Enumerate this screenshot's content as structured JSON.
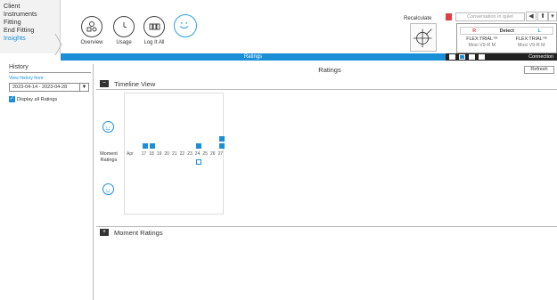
{
  "nav": {
    "items": [
      "Client",
      "Instruments",
      "Fitting",
      "End Fitting",
      "Insights"
    ],
    "active_index": 4
  },
  "tools": [
    {
      "label": "Overview",
      "icon": "overview-icon"
    },
    {
      "label": "Usage",
      "icon": "clock-icon"
    },
    {
      "label": "Log It All",
      "icon": "log-icon"
    }
  ],
  "ribbon": {
    "label": "Ratings"
  },
  "right_panel": {
    "recalculate_label": "Recalculate",
    "program_placeholder": "Conversation in quiet",
    "device": {
      "left_label": "R",
      "detect_label": "Detect",
      "right_label": "L",
      "left_name": "FLEX:TRIAL™",
      "left_model": "Moxi V9-R M",
      "right_name": "FLEX:TRIAL™",
      "right_model": "Moxi V9-R M"
    },
    "connection_label": "Connection",
    "plus": "+"
  },
  "sidebar": {
    "title": "History",
    "view_label": "View history from:",
    "range_value": "2023-04-14 - 2023-04-28",
    "display_all_label": "Display all Ratings"
  },
  "main": {
    "title": "Ratings",
    "refresh_label": "Refresh",
    "timeline_section": {
      "toggle": "−",
      "title": "Timeline View"
    },
    "moment_section": {
      "toggle": "+",
      "title": "Moment Ratings"
    },
    "row_label_line1": "Moment",
    "row_label_line2": "Ratings"
  },
  "chart_data": {
    "type": "scatter",
    "x": [
      "Apr",
      "17",
      "18",
      "19",
      "20",
      "21",
      "22",
      "23",
      "24",
      "25",
      "26",
      "27"
    ],
    "ratings": [
      {
        "day": "17",
        "level": "positive",
        "count": 1
      },
      {
        "day": "18",
        "level": "positive",
        "count": 1
      },
      {
        "day": "24",
        "level": "positive",
        "count": 1
      },
      {
        "day": "24",
        "level": "negative",
        "count": 1,
        "style": "outline"
      },
      {
        "day": "27",
        "level": "positive",
        "count": 2
      }
    ],
    "colors": {
      "accent": "#1a8fd8"
    }
  }
}
